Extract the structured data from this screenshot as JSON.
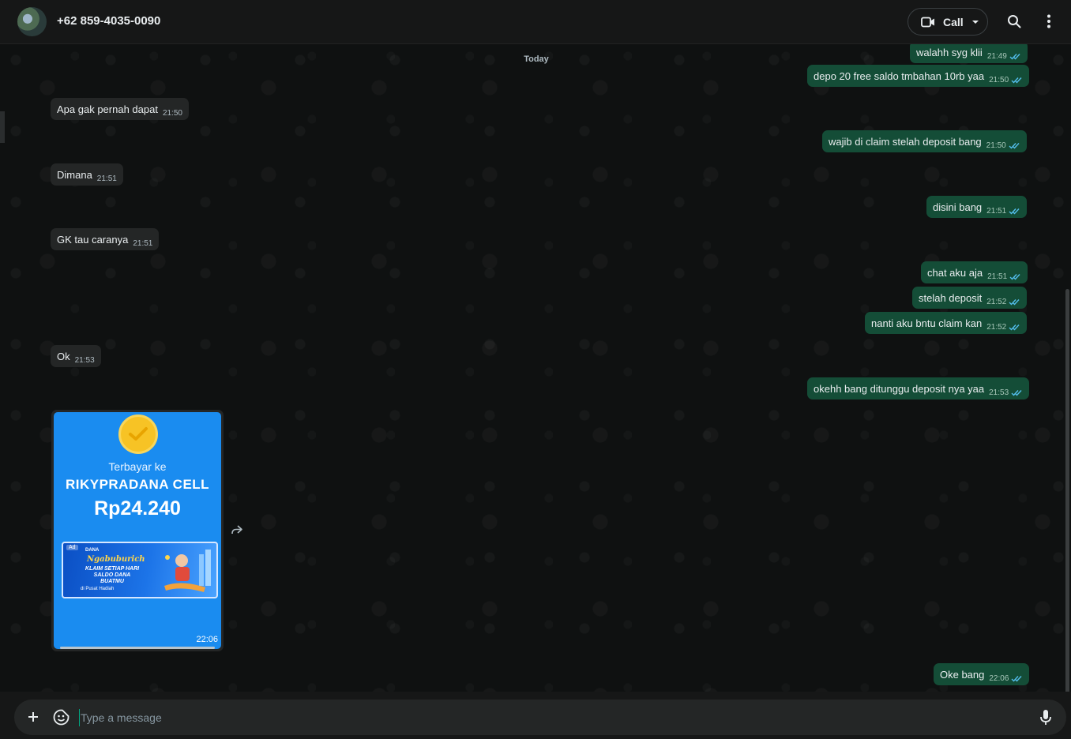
{
  "header": {
    "contact_name": "+62 859-4035-0090",
    "call_label": "Call"
  },
  "chat": {
    "date_chip": "Today",
    "incoming": [
      {
        "text": "Apa gak pernah dapat",
        "time": "21:50"
      },
      {
        "text": "Dimana",
        "time": "21:51"
      },
      {
        "text": "GK tau caranya",
        "time": "21:51"
      },
      {
        "text": "Ok",
        "time": "21:53"
      }
    ],
    "outgoing": [
      {
        "text": "walahh syg klii",
        "time": "21:49"
      },
      {
        "text": "depo 20 free saldo tmbahan 10rb yaa",
        "time": "21:50"
      },
      {
        "text": "wajib di claim stelah deposit bang",
        "time": "21:50"
      },
      {
        "text": "disini bang",
        "time": "21:51"
      },
      {
        "text": "chat aku aja",
        "time": "21:51"
      },
      {
        "text": "stelah deposit",
        "time": "21:52"
      },
      {
        "text": "nanti aku bntu claim kan",
        "time": "21:52"
      },
      {
        "text": "okehh bang ditunggu deposit nya yaa",
        "time": "21:53"
      },
      {
        "text": "Oke bang",
        "time": "22:06"
      }
    ],
    "image_message": {
      "paid_label": "Terbayar ke",
      "paid_name": "RIKYPRADANA CELL",
      "amount": "Rp24.240",
      "ad": {
        "tag": "Ad",
        "brand": "DANA",
        "title": "Ngabuburich",
        "line1": "KLAIM SETIAP HARI",
        "line2": "SALDO DANA",
        "line3": "BUATMU",
        "footer": "di Pusat Hadiah"
      },
      "time": "22:06"
    }
  },
  "composer": {
    "placeholder": "Type a message"
  },
  "colors": {
    "incoming_bubble": "#242626",
    "outgoing_bubble": "#144d37",
    "read_ticks": "#53bdeb",
    "payment_blue": "#1a8cf0"
  }
}
